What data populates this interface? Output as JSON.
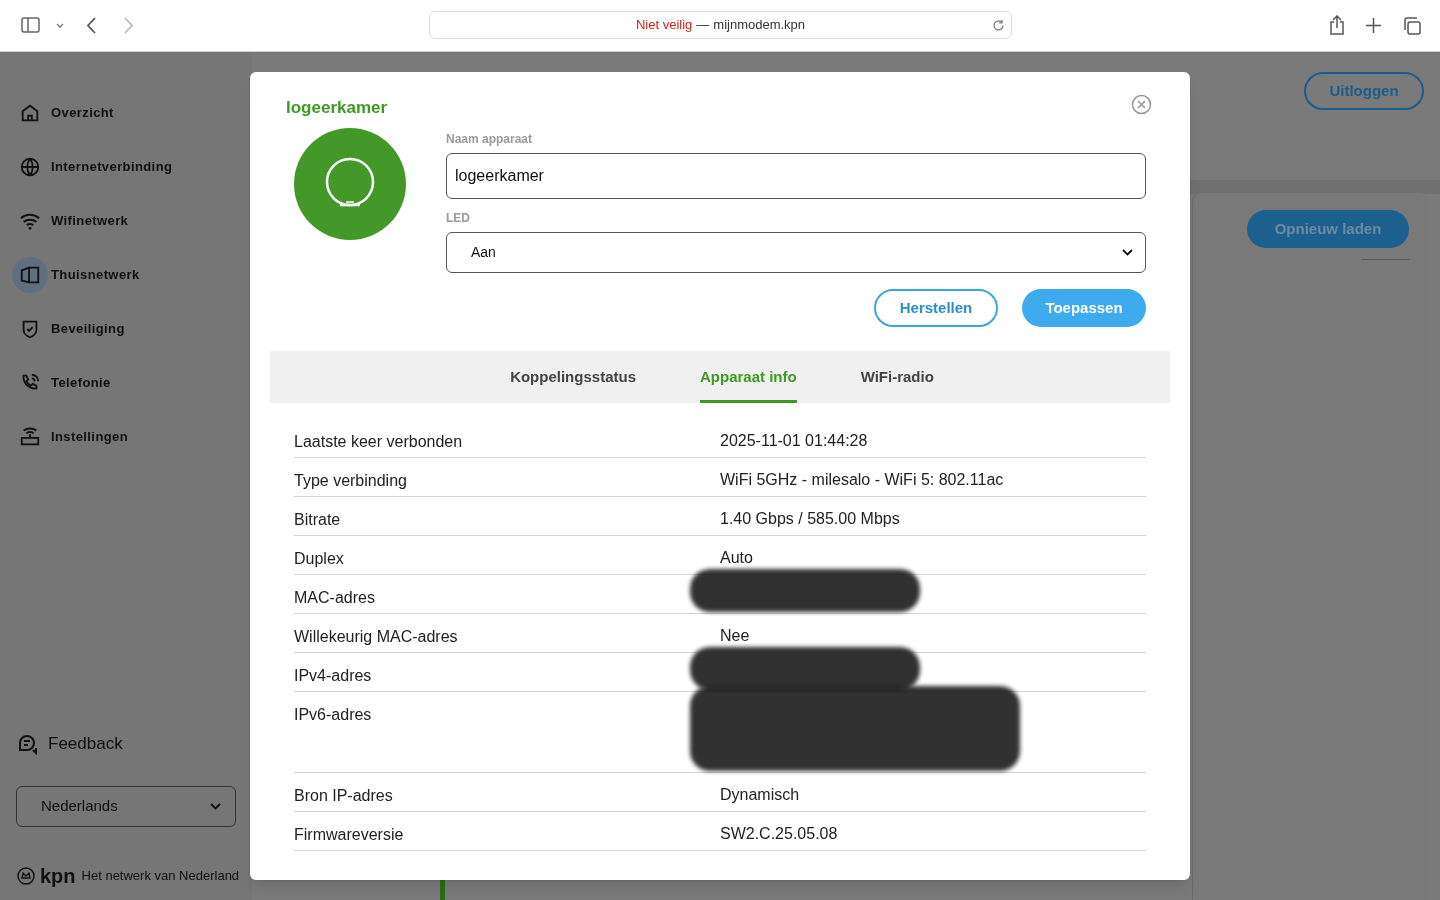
{
  "browser": {
    "url_warning": "Niet veilig",
    "url_separator": "—",
    "url": "mijnmodem.kpn"
  },
  "sidebar": {
    "items": [
      {
        "label": "Overzicht",
        "selected": false
      },
      {
        "label": "Internetverbinding",
        "selected": false
      },
      {
        "label": "Wifinetwerk",
        "selected": false
      },
      {
        "label": "Thuisnetwerk",
        "selected": true
      },
      {
        "label": "Beveiliging",
        "selected": false
      },
      {
        "label": "Telefonie",
        "selected": false
      },
      {
        "label": "Instellingen",
        "selected": false
      }
    ],
    "feedback": "Feedback",
    "language": "Nederlands",
    "brand": "kpn",
    "tagline": "Het netwerk van Nederland"
  },
  "background": {
    "logout_button": "Uitloggen",
    "reload_button": "Opnieuw laden"
  },
  "dialog": {
    "title": "logeerkamer",
    "name_field": {
      "label": "Naam apparaat",
      "value": "logeerkamer"
    },
    "led_field": {
      "label": "LED",
      "value": "Aan"
    },
    "buttons": [
      {
        "label": "Herstellen",
        "kind": "outline"
      },
      {
        "label": "Toepassen",
        "kind": "primary"
      }
    ],
    "tabs": [
      {
        "label": "Koppelingsstatus",
        "selected": false
      },
      {
        "label": "Apparaat info",
        "selected": true
      },
      {
        "label": "WiFi-radio",
        "selected": false
      }
    ],
    "rows": [
      {
        "label": "Laatste keer verbonden",
        "kind": "text",
        "values": [
          "2025-11-01 01:44:28"
        ]
      },
      {
        "label": "Type verbinding",
        "kind": "text",
        "values": [
          "WiFi 5GHz - milesalo - WiFi 5: 802.11ac"
        ]
      },
      {
        "label": "Bitrate",
        "kind": "text",
        "values": [
          "1.40 Gbps / 585.00 Mbps"
        ]
      },
      {
        "label": "Duplex",
        "kind": "text",
        "values": [
          "Auto"
        ]
      },
      {
        "label": "MAC-adres",
        "kind": "redacted"
      },
      {
        "label": "Willekeurig MAC-adres",
        "kind": "text",
        "values": [
          "Nee"
        ]
      },
      {
        "label": "IPv4-adres",
        "kind": "redacted"
      },
      {
        "label": "IPv6-adres",
        "kind": "redacted-tall"
      },
      {
        "label": "Bron IP-adres",
        "kind": "text",
        "values": [
          "Dynamisch"
        ]
      },
      {
        "label": "Firmwareversie",
        "kind": "text",
        "values": [
          "SW2.C.25.05.08"
        ]
      }
    ]
  }
}
